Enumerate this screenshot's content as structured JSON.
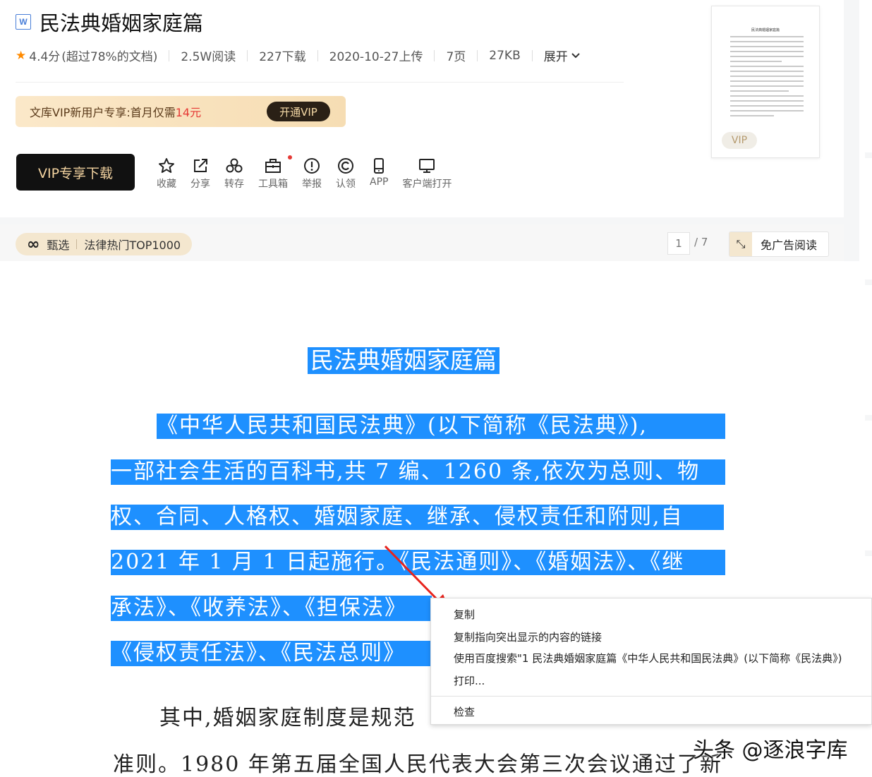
{
  "doc": {
    "type_icon": "W",
    "title": "民法典婚姻家庭篇",
    "rating": "4.4分",
    "rating_note": "(超过78%的文档)",
    "reads": "2.5W阅读",
    "downloads": "227下载",
    "upload_date": "2020-10-27上传",
    "pages": "7页",
    "size": "27KB",
    "expand_label": "展开"
  },
  "vip_banner": {
    "text": "文库VIP新用户专享:首月仅需",
    "price": "14元",
    "button": "开通VIP"
  },
  "download_button": "VIP专享下载",
  "tools": [
    {
      "label": "收藏",
      "icon": "star-outline-icon"
    },
    {
      "label": "分享",
      "icon": "share-icon"
    },
    {
      "label": "转存",
      "icon": "save-to-icon"
    },
    {
      "label": "工具箱",
      "icon": "toolbox-icon"
    },
    {
      "label": "举报",
      "icon": "report-icon"
    },
    {
      "label": "认领",
      "icon": "copyright-icon"
    },
    {
      "label": "APP",
      "icon": "phone-icon"
    },
    {
      "label": "客户端打开",
      "icon": "monitor-icon"
    }
  ],
  "thumbnail": {
    "title": "民法典婚姻家庭篇",
    "vip_label": "VIP"
  },
  "sub_bar": {
    "tag_brand": "甄选",
    "tag_text": "法律热门TOP1000",
    "current_page": "1",
    "total_pages": "/ 7",
    "adfree_label": "免广告阅读"
  },
  "body": {
    "title": "民法典婚姻家庭篇",
    "lines": [
      "《中华人民共和国民法典》(以下简称《民法典》),",
      "一部社会生活的百科书,共 7 编、1260 条,依次为总则、物",
      "权、合同、人格权、婚姻家庭、继承、侵权责任和附则,自",
      "2021 年 1 月 1 日起施行。《民法通则》、《婚姻法》、《继",
      "承法》、《收养法》、《担保法》",
      "《侵权责任法》、《民法总则》"
    ],
    "plain_lines": [
      "其中,婚姻家庭制度是规范",
      "准则。1980 年第五届全国人民代表大会第三次会议通过了新"
    ]
  },
  "context_menu": {
    "items": [
      "复制",
      "复制指向突出显示的内容的链接",
      "使用百度搜索\"1 民法典婚姻家庭篇《中华人民共和国民法典》(以下简称《民法典》)",
      "打印...",
      "检查"
    ]
  },
  "watermark": "头条 @逐浪字库",
  "colors": {
    "selection": "#1e90ff",
    "vip_gold": "#f3d3a0",
    "star": "#ff8a00",
    "price_red": "#e53935"
  }
}
